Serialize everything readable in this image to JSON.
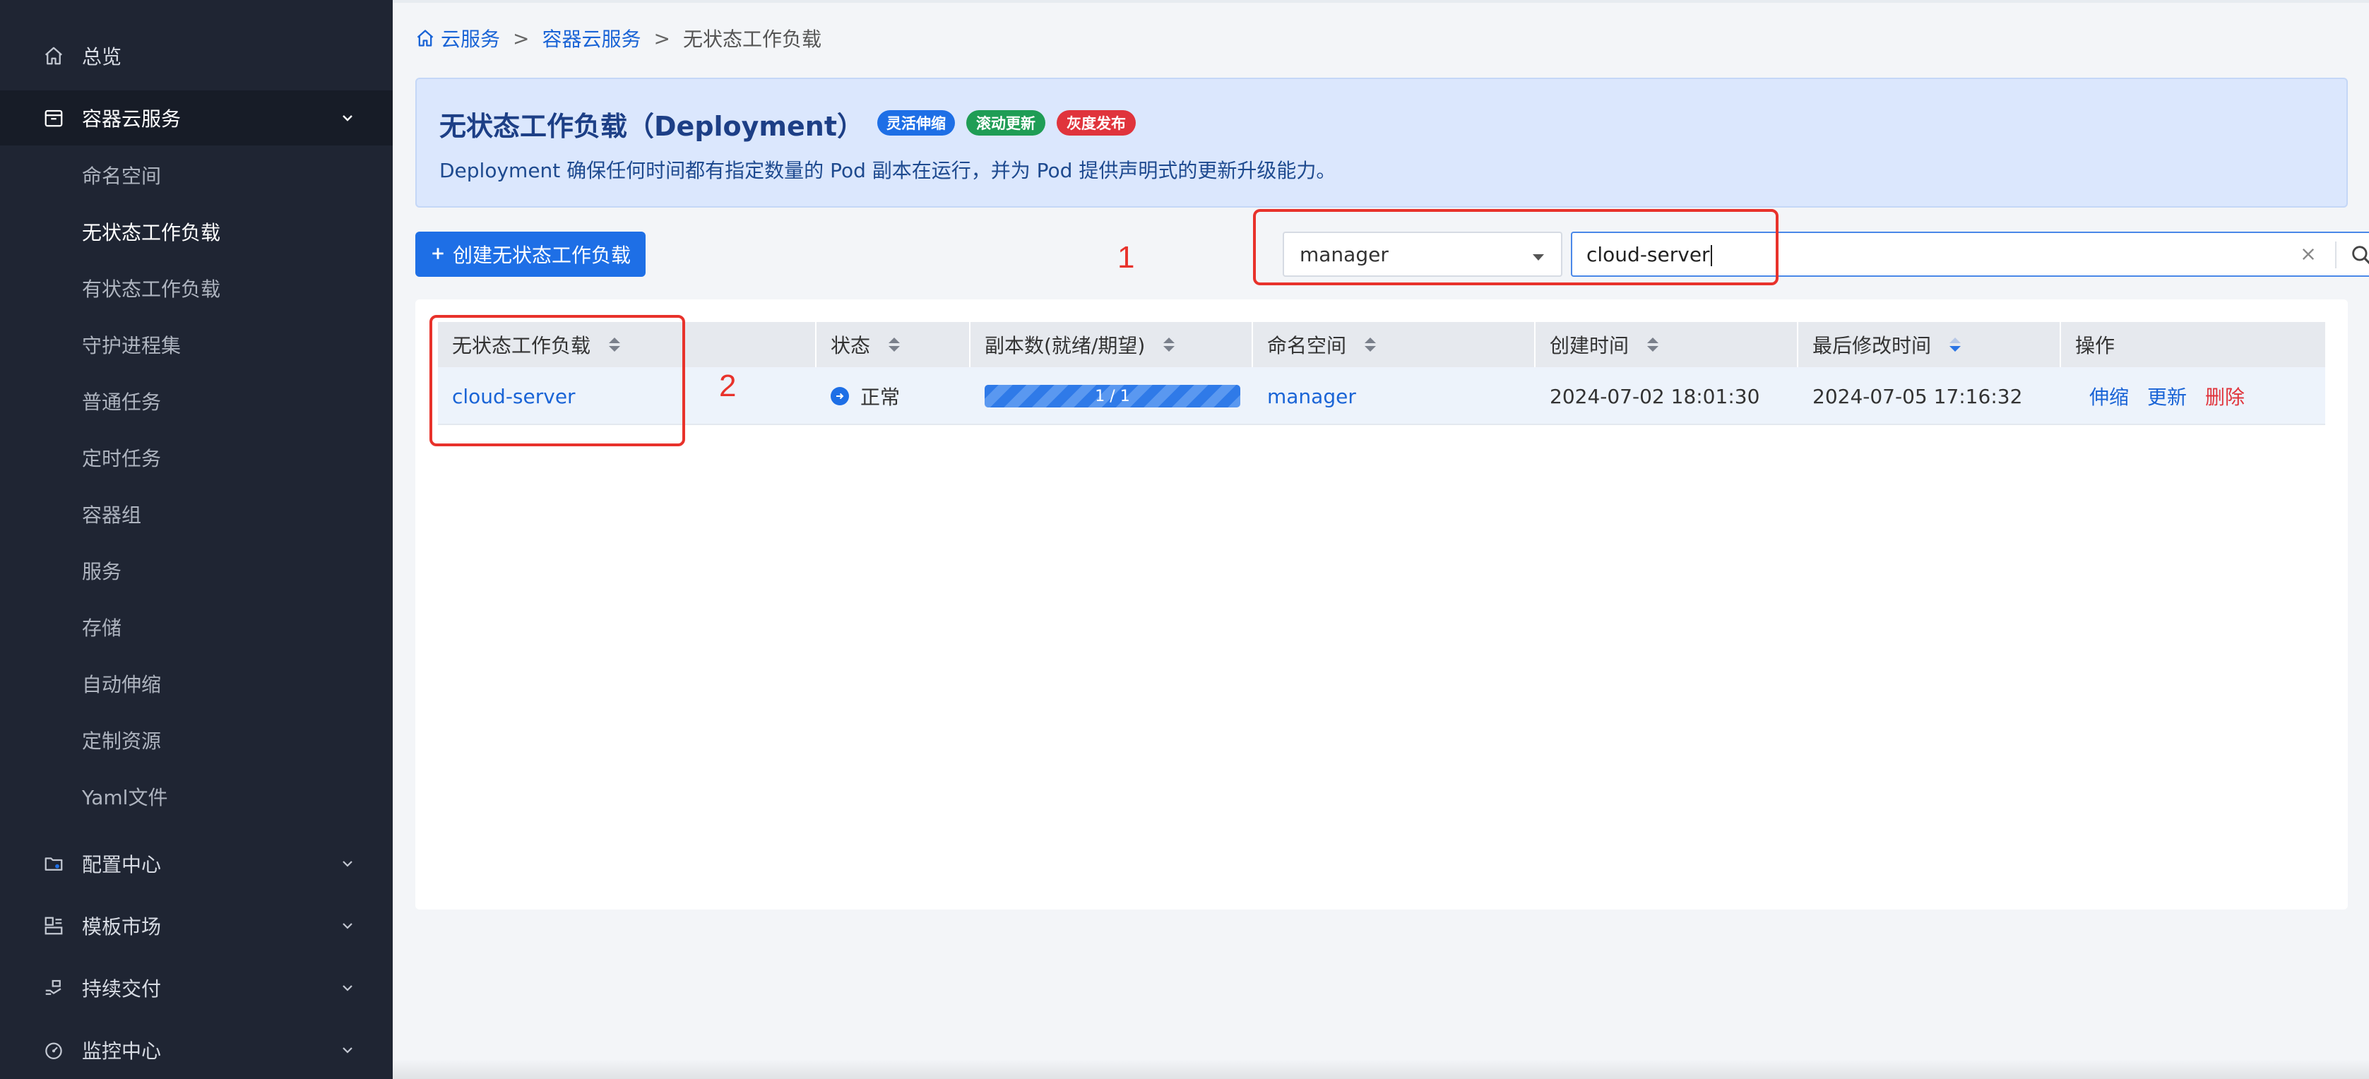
{
  "sidebar": {
    "groups": [
      {
        "label": "总览",
        "icon": "home-icon"
      },
      {
        "label": "容器云服务",
        "icon": "container-icon"
      },
      {
        "label": "配置中心",
        "icon": "config-folder-icon"
      },
      {
        "label": "模板市场",
        "icon": "template-icon"
      },
      {
        "label": "持续交付",
        "icon": "delivery-icon"
      },
      {
        "label": "监控中心",
        "icon": "monitor-icon"
      }
    ],
    "sub_items": [
      {
        "label": "命名空间"
      },
      {
        "label": "无状态工作负载"
      },
      {
        "label": "有状态工作负载"
      },
      {
        "label": "守护进程集"
      },
      {
        "label": "普通任务"
      },
      {
        "label": "定时任务"
      },
      {
        "label": "容器组"
      },
      {
        "label": "服务"
      },
      {
        "label": "存储"
      },
      {
        "label": "自动伸缩"
      },
      {
        "label": "定制资源"
      },
      {
        "label": "Yaml文件"
      }
    ],
    "active_sub_item": "无状态工作负载"
  },
  "breadcrumb": {
    "items": [
      "云服务",
      "容器云服务",
      "无状态工作负载"
    ],
    "separator": ">"
  },
  "banner": {
    "title": "无状态工作负载（Deployment）",
    "tags": [
      {
        "label": "灵活伸缩",
        "color": "#1e6fe6"
      },
      {
        "label": "滚动更新",
        "color": "#1f9d55"
      },
      {
        "label": "灰度发布",
        "color": "#e0343c"
      }
    ],
    "description": "Deployment 确保任何时间都有指定数量的 Pod 副本在运行，并为 Pod 提供声明式的更新升级能力。"
  },
  "toolbar": {
    "create_label": "创建无状态工作负载",
    "namespace_value": "manager",
    "search_value": "cloud-server"
  },
  "annotations": [
    "1",
    "2"
  ],
  "table": {
    "headers": [
      "无状态工作负载",
      "状态",
      "副本数(就绪/期望)",
      "命名空间",
      "创建时间",
      "最后修改时间",
      "操作"
    ],
    "rows": [
      {
        "name": "cloud-server",
        "status": "正常",
        "replicas": "1 / 1",
        "replicas_ready_fraction": 1.0,
        "namespace": "manager",
        "created": "2024-07-02 18:01:30",
        "modified": "2024-07-05 17:16:32",
        "actions": [
          "伸缩",
          "更新",
          "删除"
        ]
      }
    ]
  },
  "colors": {
    "primary": "#1e6fe6",
    "danger": "#e0343c",
    "annotation": "#e8322b",
    "sidebar_bg": "#1f2533"
  }
}
